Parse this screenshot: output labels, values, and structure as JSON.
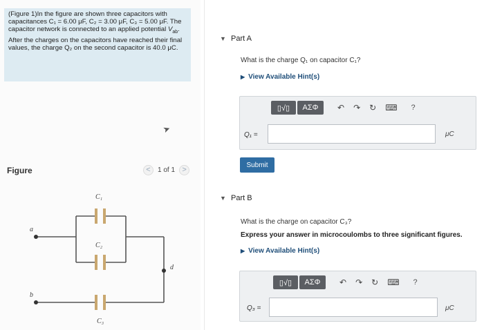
{
  "problem": {
    "text_1": "(Figure 1)In the figure are shown three capacitors with capacitances",
    "text_2": "C₁ = 6.00 μF, C₂ = 3.00 μF, C₃ = 5.00 μF. The capacitor network is connected to an applied potential",
    "text_3": "V",
    "text_3_sub": "ab",
    "text_4": ". After the charges on the capacitors have reached their final values, the charge Q₂ on the second capacitor is 40.0 μC."
  },
  "figure": {
    "label": "Figure",
    "pager": "1 of 1",
    "prev": "<",
    "next": ">",
    "circuit_labels": {
      "a": "a",
      "b": "b",
      "d": "d",
      "c1": "C₁",
      "c2": "C₂",
      "c3": "C₃"
    }
  },
  "partA": {
    "caret": "▼",
    "title": "Part A",
    "question": "What is the charge Q₁ on capacitor C₁?",
    "hint_arrow": "▶",
    "hint": "View Available Hint(s)",
    "toolbar": {
      "templates": "▯√▯",
      "symbols": "ΑΣΦ",
      "undo": "↶",
      "redo": "↷",
      "reset": "↻",
      "keyboard": "⌨",
      "help": "?"
    },
    "var_label": "Q₁ =",
    "input_value": "",
    "unit": "μC",
    "submit": "Submit"
  },
  "partB": {
    "caret": "▼",
    "title": "Part B",
    "question": "What is the charge on capacitor C₃?",
    "instruction": "Express your answer in microcoulombs to three significant figures.",
    "hint_arrow": "▶",
    "hint": "View Available Hint(s)",
    "toolbar": {
      "templates": "▯√▯",
      "symbols": "ΑΣΦ",
      "undo": "↶",
      "redo": "↷",
      "reset": "↻",
      "keyboard": "⌨",
      "help": "?"
    },
    "var_label": "Q₃ =",
    "input_value": "",
    "unit": "μC"
  }
}
